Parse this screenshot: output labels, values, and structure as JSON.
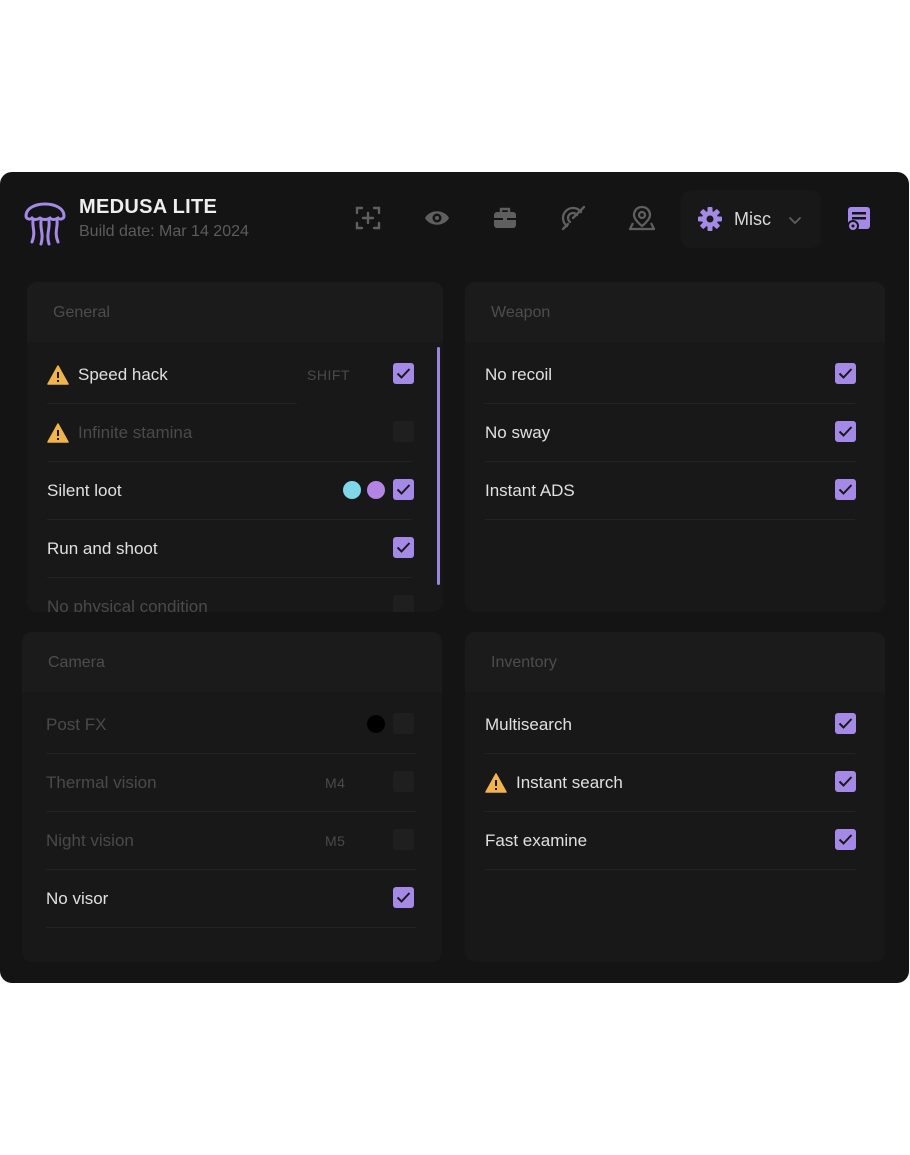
{
  "app": {
    "title": "MEDUSA LITE",
    "build": "Build date: Mar 14 2024",
    "accent": "#a48ae6"
  },
  "nav": {
    "icons": [
      "aim-icon",
      "eye-icon",
      "briefcase-icon",
      "radar-icon",
      "map-pin-icon"
    ],
    "active_tab": {
      "icon": "gear-icon",
      "label": "Misc"
    },
    "settings_icon": "settings-list-icon"
  },
  "panels": {
    "general": {
      "title": "General",
      "items": [
        {
          "label": "Speed hack",
          "warning": true,
          "key": "SHIFT",
          "checked": true,
          "enabled": true
        },
        {
          "label": "Infinite stamina",
          "warning": true,
          "checked": false,
          "enabled": false
        },
        {
          "label": "Silent loot",
          "warning": false,
          "colors": [
            "#7fd8e8",
            "#b484e4"
          ],
          "checked": true,
          "enabled": true
        },
        {
          "label": "Run and shoot",
          "warning": false,
          "checked": true,
          "enabled": true
        },
        {
          "label": "No physical condition",
          "warning": false,
          "checked": false,
          "enabled": false
        }
      ]
    },
    "weapon": {
      "title": "Weapon",
      "items": [
        {
          "label": "No recoil",
          "checked": true
        },
        {
          "label": "No sway",
          "checked": true
        },
        {
          "label": "Instant ADS",
          "checked": true
        }
      ]
    },
    "camera": {
      "title": "Camera",
      "items": [
        {
          "label": "Post FX",
          "colors": [
            "#000000"
          ],
          "checked": false,
          "enabled": false
        },
        {
          "label": "Thermal vision",
          "key": "M4",
          "checked": false,
          "enabled": false
        },
        {
          "label": "Night vision",
          "key": "M5",
          "checked": false,
          "enabled": false
        },
        {
          "label": "No visor",
          "checked": true,
          "enabled": true
        }
      ]
    },
    "inventory": {
      "title": "Inventory",
      "items": [
        {
          "label": "Multisearch",
          "warning": false,
          "checked": true
        },
        {
          "label": "Instant search",
          "warning": true,
          "checked": true
        },
        {
          "label": "Fast examine",
          "warning": false,
          "checked": true
        }
      ]
    }
  }
}
